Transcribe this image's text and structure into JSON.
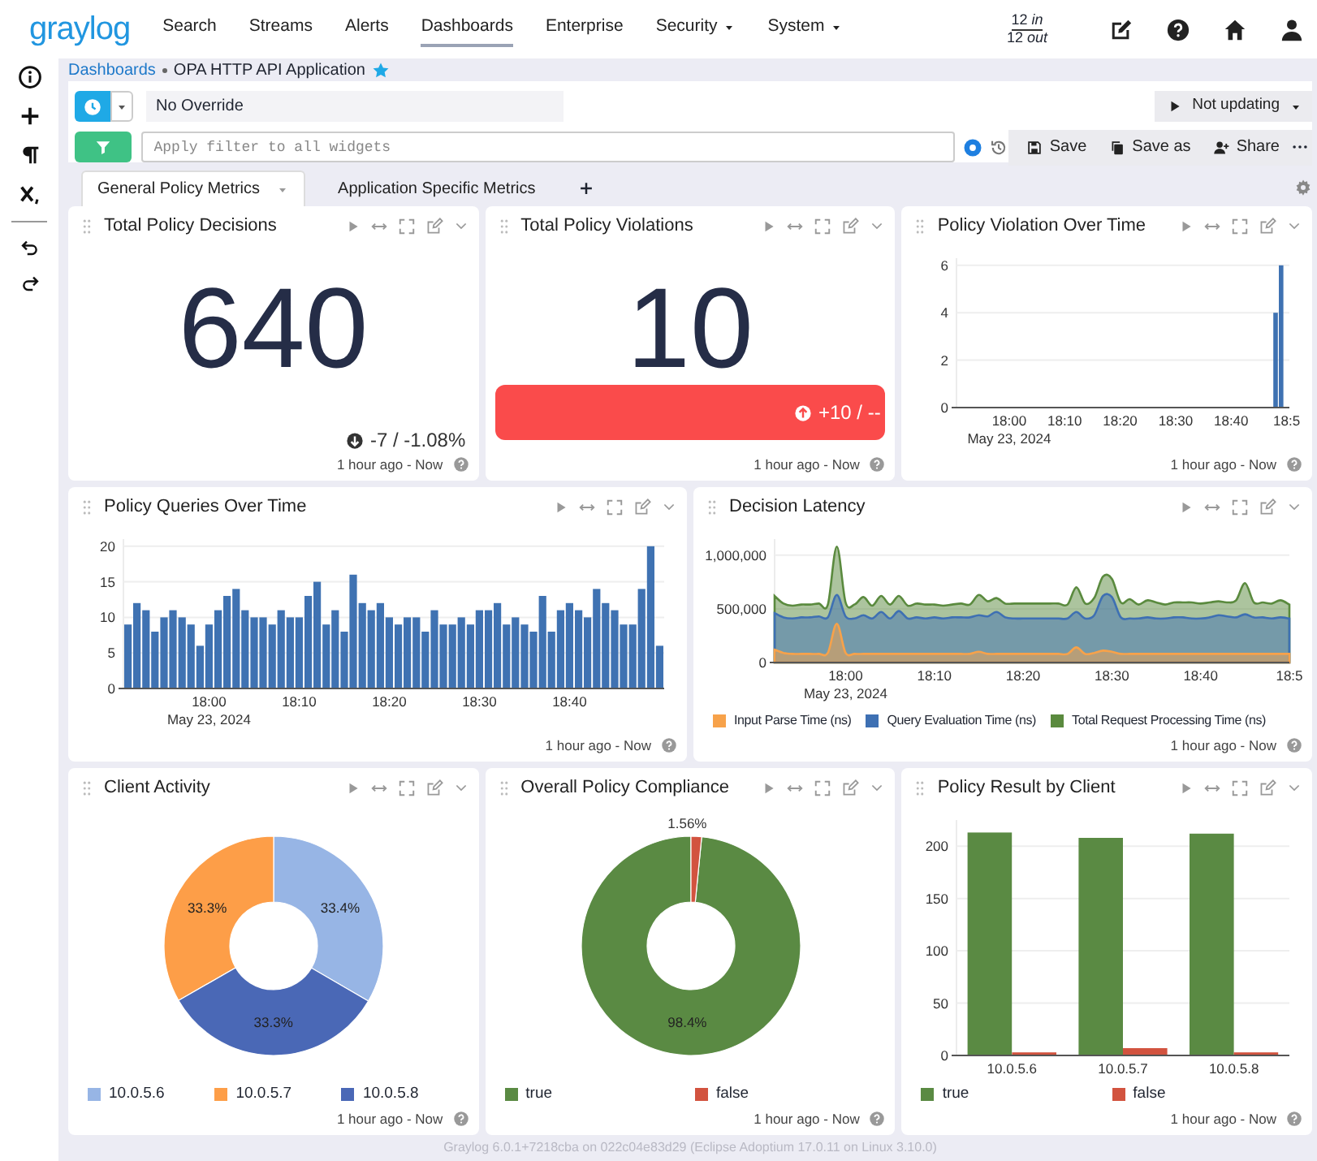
{
  "navbar": {
    "logo": "graylog",
    "items": [
      {
        "label": "Search",
        "selected": false,
        "dropdown": false
      },
      {
        "label": "Streams",
        "selected": false,
        "dropdown": false
      },
      {
        "label": "Alerts",
        "selected": false,
        "dropdown": false
      },
      {
        "label": "Dashboards",
        "selected": true,
        "dropdown": false
      },
      {
        "label": "Enterprise",
        "selected": false,
        "dropdown": false
      },
      {
        "label": "Security",
        "selected": false,
        "dropdown": true
      },
      {
        "label": "System",
        "selected": false,
        "dropdown": true
      }
    ],
    "throughput": {
      "in": "12 *in*",
      "out": "12 *out*"
    }
  },
  "dashboard": {
    "breadcrumb_root": "Dashboards",
    "title": "OPA HTTP API Application",
    "favorite": true
  },
  "search_bar": {
    "timerange": "No Override",
    "refresh": "Not updating",
    "query_placeholder": "Apply filter to all widgets",
    "actions": [
      {
        "label": "Save",
        "kind": "save"
      },
      {
        "label": "Save as",
        "kind": "copy"
      },
      {
        "label": "Share",
        "kind": "share"
      }
    ]
  },
  "tabs": [
    {
      "label": "General Policy Metrics",
      "selected": true
    },
    {
      "label": "Application Specific Metrics",
      "selected": false
    }
  ],
  "widgets": [
    {
      "title": "Total Policy Decisions",
      "kind": "number",
      "value": "640",
      "delta": "-7 / -1.08%",
      "increase": false,
      "alert": false,
      "timerange": "1 hour ago - Now"
    },
    {
      "title": "Total Policy Violations",
      "kind": "number",
      "value": "10",
      "delta": "+10 / --",
      "increase": true,
      "alert": true,
      "timerange": "1 hour ago - Now"
    },
    {
      "title": "Policy Violation Over Time",
      "kind": "chart",
      "date_label": "May 23, 2024",
      "timerange": "1 hour ago - Now",
      "chart_data": {
        "type": "bar",
        "grid": true,
        "categories": [
          null,
          null,
          null,
          null,
          null,
          null,
          null,
          null,
          null,
          "18:00",
          null,
          null,
          null,
          null,
          null,
          null,
          null,
          null,
          null,
          "18:10",
          null,
          null,
          null,
          null,
          null,
          null,
          null,
          null,
          null,
          "18:20",
          null,
          null,
          null,
          null,
          null,
          null,
          null,
          null,
          null,
          "18:30",
          null,
          null,
          null,
          null,
          null,
          null,
          null,
          null,
          null,
          "18:40",
          null,
          null,
          null,
          null,
          null,
          null,
          null,
          null,
          null,
          "18:5"
        ],
        "series": [
          {
            "color": "#3f72b2",
            "values": [
              null,
              null,
              null,
              null,
              null,
              null,
              null,
              null,
              null,
              null,
              null,
              null,
              null,
              null,
              null,
              null,
              null,
              null,
              null,
              null,
              null,
              null,
              null,
              null,
              null,
              null,
              null,
              null,
              null,
              null,
              null,
              null,
              null,
              null,
              null,
              null,
              null,
              null,
              null,
              null,
              null,
              null,
              null,
              null,
              null,
              null,
              null,
              null,
              null,
              null,
              null,
              null,
              null,
              null,
              null,
              null,
              null,
              4,
              6,
              null
            ]
          }
        ],
        "ylim": [
          0,
          6.3
        ],
        "yticks": [
          0,
          2,
          4,
          6
        ]
      }
    },
    {
      "title": "Policy Queries Over Time",
      "kind": "chart",
      "date_label": "May 23, 2024",
      "timerange": "1 hour ago - Now",
      "chart_data": {
        "type": "bar",
        "grid": true,
        "categories": [
          null,
          null,
          null,
          null,
          null,
          null,
          null,
          null,
          null,
          "18:00",
          null,
          null,
          null,
          null,
          null,
          null,
          null,
          null,
          null,
          "18:10",
          null,
          null,
          null,
          null,
          null,
          null,
          null,
          null,
          null,
          "18:20",
          null,
          null,
          null,
          null,
          null,
          null,
          null,
          null,
          null,
          "18:30",
          null,
          null,
          null,
          null,
          null,
          null,
          null,
          null,
          null,
          "18:40",
          null,
          null,
          null,
          null,
          null,
          null,
          null,
          null,
          null,
          null
        ],
        "series": [
          {
            "color": "#3f72b2",
            "values": [
              9,
              12,
              11,
              8,
              10,
              11,
              10,
              9,
              6,
              9,
              11,
              13,
              14,
              11,
              10,
              10,
              9,
              11,
              10,
              10,
              13,
              15,
              9,
              11,
              8,
              16,
              12,
              11,
              12,
              10,
              9,
              10,
              10,
              8,
              11,
              9,
              9,
              10,
              9,
              11,
              11,
              12,
              9,
              10,
              9,
              8,
              13,
              8,
              11,
              12,
              11,
              10,
              14,
              12,
              11,
              9,
              9,
              14,
              20,
              6
            ]
          }
        ],
        "ylim": [
          0,
          21
        ],
        "yticks": [
          0,
          5,
          10,
          15,
          20
        ]
      }
    },
    {
      "title": "Decision Latency",
      "kind": "chart",
      "date_label": "May 23, 2024",
      "timerange": "1 hour ago - Now",
      "chart_data": {
        "type": "area",
        "grid": true,
        "categories": [
          null,
          null,
          null,
          null,
          null,
          null,
          null,
          null,
          "18:00",
          null,
          null,
          null,
          null,
          null,
          null,
          null,
          null,
          null,
          "18:10",
          null,
          null,
          null,
          null,
          null,
          null,
          null,
          null,
          null,
          "18:20",
          null,
          null,
          null,
          null,
          null,
          null,
          null,
          null,
          null,
          "18:30",
          null,
          null,
          null,
          null,
          null,
          null,
          null,
          null,
          null,
          "18:40",
          null,
          null,
          null,
          null,
          null,
          null,
          null,
          null,
          null,
          "18:5"
        ],
        "series": [
          {
            "name": "Input Parse Time (ns)",
            "color": "#f7a24a",
            "values": [
              120000,
              90000,
              80000,
              80000,
              80000,
              80000,
              90000,
              360000,
              90000,
              80000,
              80000,
              80000,
              80000,
              80000,
              80000,
              80000,
              80000,
              80000,
              80000,
              80000,
              80000,
              80000,
              80000,
              100000,
              80000,
              80000,
              80000,
              80000,
              80000,
              80000,
              80000,
              80000,
              80000,
              80000,
              140000,
              80000,
              90000,
              110000,
              100000,
              80000,
              80000,
              80000,
              80000,
              80000,
              80000,
              80000,
              80000,
              80000,
              80000,
              80000,
              80000,
              80000,
              80000,
              80000,
              80000,
              80000,
              80000,
              80000,
              80000
            ]
          },
          {
            "name": "Query Evaluation Time (ns)",
            "color": "#3e70b3",
            "values": [
              460000,
              420000,
              410000,
              420000,
              420000,
              430000,
              420000,
              630000,
              430000,
              410000,
              440000,
              410000,
              470000,
              410000,
              480000,
              410000,
              420000,
              410000,
              420000,
              410000,
              420000,
              420000,
              420000,
              440000,
              430000,
              470000,
              420000,
              410000,
              410000,
              410000,
              410000,
              410000,
              410000,
              410000,
              470000,
              410000,
              440000,
              620000,
              610000,
              420000,
              410000,
              410000,
              420000,
              410000,
              410000,
              420000,
              420000,
              410000,
              410000,
              420000,
              440000,
              430000,
              420000,
              450000,
              420000,
              420000,
              410000,
              420000,
              410000
            ]
          },
          {
            "name": "Total Request Processing Time (ns)",
            "color": "#5a8a3e",
            "values": [
              620000,
              550000,
              530000,
              540000,
              540000,
              550000,
              540000,
              1080000,
              560000,
              540000,
              610000,
              530000,
              620000,
              540000,
              620000,
              530000,
              550000,
              540000,
              540000,
              530000,
              540000,
              550000,
              540000,
              630000,
              570000,
              600000,
              550000,
              550000,
              550000,
              550000,
              550000,
              550000,
              550000,
              540000,
              700000,
              550000,
              600000,
              800000,
              780000,
              560000,
              590000,
              540000,
              580000,
              560000,
              540000,
              560000,
              560000,
              560000,
              550000,
              560000,
              570000,
              560000,
              580000,
              740000,
              560000,
              560000,
              550000,
              580000,
              540000
            ]
          }
        ],
        "ylim": [
          0,
          1150000
        ],
        "yticks": [
          {
            "value": 0,
            "label": "0"
          },
          {
            "value": 500000,
            "label": "500,000"
          },
          {
            "value": 1000000,
            "label": "1,000,000"
          }
        ]
      }
    },
    {
      "title": "Client Activity",
      "kind": "chart",
      "timerange": "1 hour ago - Now",
      "chart_data": {
        "type": "donut",
        "categories": [
          "10.0.5.6",
          "10.0.5.7",
          "10.0.5.8"
        ],
        "values": [
          33.4,
          33.3,
          33.3
        ],
        "colors": [
          "#97b5e5",
          "#fd9e48",
          "#4a68b6"
        ],
        "value_labels": [
          "33.4%",
          "33.3%",
          "33.3%"
        ]
      }
    },
    {
      "title": "Overall Policy Compliance",
      "kind": "chart",
      "timerange": "1 hour ago - Now",
      "chart_data": {
        "type": "donut",
        "categories": [
          "true",
          "false"
        ],
        "values": [
          98.4,
          1.56
        ],
        "colors": [
          "#5a8a43",
          "#d2533f"
        ],
        "value_labels": [
          "98.4%",
          "1.56%"
        ]
      }
    },
    {
      "title": "Policy Result by Client",
      "kind": "chart",
      "timerange": "1 hour ago - Now",
      "chart_data": {
        "type": "bar",
        "grid": true,
        "categories": [
          "10.0.5.6",
          "10.0.5.7",
          "10.0.5.8"
        ],
        "series": [
          {
            "name": "true",
            "color": "#5a8a43",
            "values": [
              213,
              208,
              212
            ]
          },
          {
            "name": "false",
            "color": "#d2533f",
            "values": [
              3,
              7,
              3
            ]
          }
        ],
        "ylim": [
          0,
          225
        ],
        "yticks": [
          0,
          50,
          100,
          150,
          200
        ]
      }
    }
  ],
  "footer": "Graylog 6.0.1+7218cba on 022c04e83d29 (Eclipse Adoptium 17.0.11 on Linux 3.10.0)"
}
